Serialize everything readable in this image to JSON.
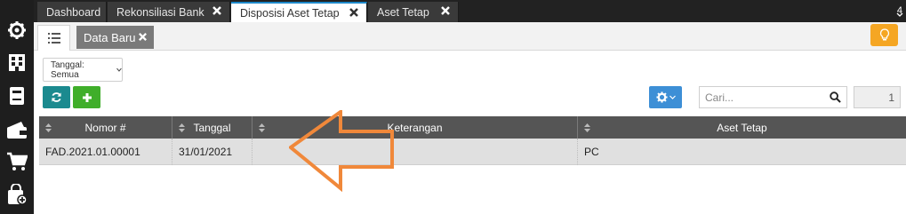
{
  "tabs": [
    {
      "label": "Dashboard",
      "closable": false
    },
    {
      "label": "Rekonsiliasi Bank",
      "closable": true
    },
    {
      "label": "Disposisi Aset Tetap",
      "closable": true,
      "active": true
    },
    {
      "label": "Aset Tetap",
      "closable": true
    }
  ],
  "tab_count": "4",
  "sidebar": {
    "icons": [
      "settings-icon",
      "building-icon",
      "ledger-icon",
      "wallet-icon",
      "cart-icon",
      "shopping-bag-icon"
    ]
  },
  "subtabs": {
    "list_icon": "list-icon",
    "new_label": "Data Baru"
  },
  "filter": {
    "date_label": "Tanggal: Semua"
  },
  "toolbar": {
    "refresh_icon": "refresh-icon",
    "add_icon": "plus-icon",
    "settings_icon": "gear-icon"
  },
  "search": {
    "placeholder": "Cari...",
    "page": "1"
  },
  "table": {
    "columns": [
      "Nomor #",
      "Tanggal",
      "Keterangan",
      "Aset Tetap"
    ],
    "rows": [
      {
        "nomor": "FAD.2021.01.00001",
        "tanggal": "31/01/2021",
        "keterangan": "",
        "aset": "PC"
      }
    ]
  },
  "colors": {
    "active_tab_accent": "#1e88c9",
    "refresh_button": "#1b8a8f",
    "add_button": "#3fae2a",
    "gear_button": "#3d8fd6",
    "bulb_button": "#f5a623",
    "annotation_arrow": "#f0883a"
  }
}
